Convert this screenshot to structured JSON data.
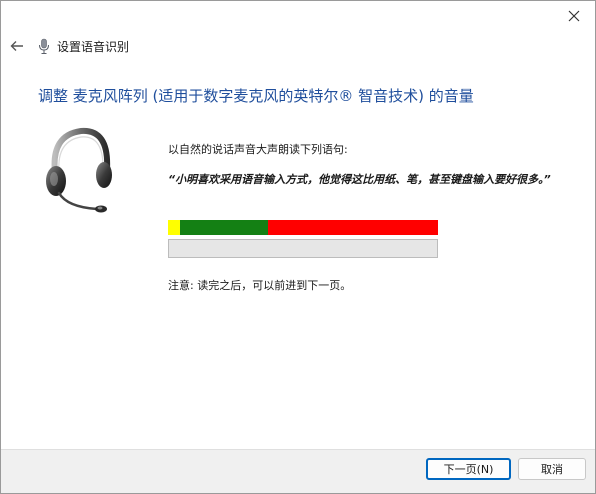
{
  "window": {
    "title": "设置语音识别"
  },
  "icons": {
    "close": "close-icon",
    "back": "back-arrow-icon",
    "app": "microphone-icon",
    "illustration": "headset-icon"
  },
  "main": {
    "heading": "调整 麦克风阵列 (适用于数字麦克风的英特尔® 智音技术) 的音量",
    "instruction": "以自然的说话声音大声朗读下列语句:",
    "quote": "“小明喜欢采用语音输入方式，他觉得这比用纸、笔，甚至键盘输入要好很多。”",
    "note": "注意: 读完之后，可以前进到下一页。"
  },
  "level_meter": {
    "zones": [
      {
        "color": "#ffff00",
        "fraction": 0.045
      },
      {
        "color": "#148014",
        "fraction": 0.325
      },
      {
        "color": "#ff0000",
        "fraction": 0.63
      }
    ]
  },
  "volume_progress": {
    "value": 0
  },
  "footer": {
    "next_label": "下一页(N)",
    "cancel_label": "取消"
  },
  "colors": {
    "heading": "#1f4e9c",
    "focus_border": "#0067c0",
    "footer_bg": "#f0f0f0"
  }
}
